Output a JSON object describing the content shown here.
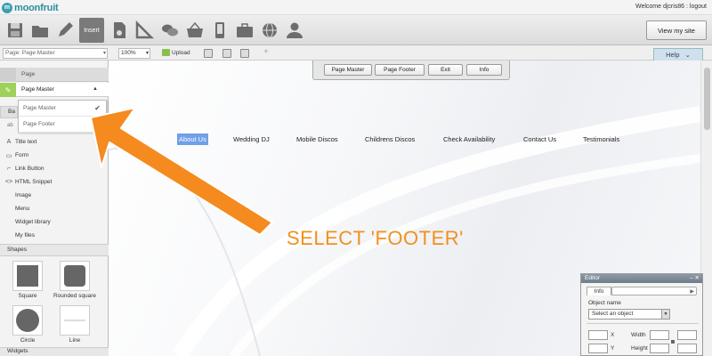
{
  "app": {
    "logo_mark": "m",
    "logo_text": "moonfruit",
    "welcome": "Welcome djcris86 : logout"
  },
  "toolbar": {
    "insert_label": "Insert",
    "view_site_label": "View my site",
    "tools": [
      "save-icon",
      "folder-icon",
      "pen-icon",
      "insert-icon",
      "page-icon",
      "ruler-icon",
      "chat-icon",
      "basket-icon",
      "mobile-icon",
      "briefcase-icon",
      "globe-icon",
      "user-icon"
    ]
  },
  "bar2": {
    "page_select": "Page: Page Master",
    "zoom": "100%",
    "upload_label": "Upload",
    "help_label": "Help",
    "plus": "+"
  },
  "page_master_bar": {
    "buttons": [
      "Page Master",
      "Page Footer",
      "Exit",
      "Info"
    ]
  },
  "nav": {
    "items": [
      "About Us",
      "Wedding DJ",
      "Mobile Discos",
      "Childrens Discos",
      "Check Availability",
      "Contact Us",
      "Testimonials"
    ]
  },
  "callout": "SELECT 'FOOTER'",
  "left_panel": {
    "page_label": "Page",
    "page_master_label": "Page Master",
    "basic_tab": "Ba",
    "abc_label": "ab",
    "items": [
      {
        "icon": "A",
        "label": "Title text"
      },
      {
        "icon": "▭",
        "label": "Form"
      },
      {
        "icon": "⌐",
        "label": "Link Button"
      },
      {
        "icon": "<>",
        "label": "HTML Snippet"
      },
      {
        "icon": "",
        "label": "Image"
      },
      {
        "icon": "",
        "label": "Menu"
      },
      {
        "icon": "",
        "label": "Widget library"
      },
      {
        "icon": "",
        "label": "My files"
      }
    ],
    "dropdown": [
      "Page Master",
      "Page Footer"
    ],
    "shapes_head": "Shapes",
    "shapes": [
      "Square",
      "Rounded square",
      "Circle",
      "Line"
    ],
    "widgets_head": "Widgets"
  },
  "editor": {
    "title": "Editor",
    "controls": "– ✕",
    "tab": "Info",
    "object_name_label": "Object name",
    "select_placeholder": "Select an object",
    "x_label": "X",
    "y_label": "Y",
    "width_label": "Width",
    "height_label": "Height"
  },
  "colors": {
    "accent": "#2a8ea0",
    "nav_active": "#6fa0e8",
    "callout": "#f2901c",
    "insert_bg": "#7a7a7a"
  }
}
